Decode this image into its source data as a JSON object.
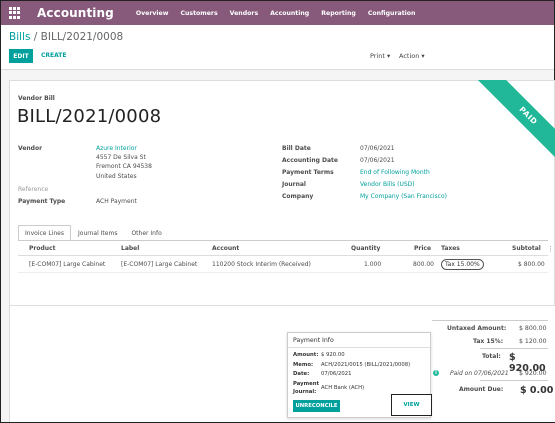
{
  "app": {
    "title": "Accounting",
    "menu": [
      "Overview",
      "Customers",
      "Vendors",
      "Accounting",
      "Reporting",
      "Configuration"
    ]
  },
  "breadcrumb": {
    "parent": "Bills",
    "separator": "/",
    "current": "BILL/2021/0008"
  },
  "toolbar": {
    "edit": "EDIT",
    "create": "CREATE",
    "print": "Print ▾",
    "action": "Action ▾"
  },
  "status_ribbon": {
    "label": "PAID",
    "color": "#21b799"
  },
  "document": {
    "type_label": "Vendor Bill",
    "number": "BILL/2021/0008"
  },
  "left_fields": {
    "vendor_label": "Vendor",
    "vendor_name": "Azure Interior",
    "vendor_address": [
      "4557 De Silva St",
      "Fremont CA 94538",
      "United States"
    ],
    "reference_label": "Reference",
    "payment_type_label": "Payment Type",
    "payment_type_value": "ACH Payment"
  },
  "right_fields": {
    "bill_date_label": "Bill Date",
    "bill_date": "07/06/2021",
    "accounting_date_label": "Accounting Date",
    "accounting_date": "07/06/2021",
    "payment_terms_label": "Payment Terms",
    "payment_terms": "End of Following Month",
    "journal_label": "Journal",
    "journal": "Vendor Bills (USD)",
    "company_label": "Company",
    "company": "My Company (San Francisco)"
  },
  "tabs": [
    "Invoice Lines",
    "Journal Items",
    "Other Info"
  ],
  "table": {
    "columns": {
      "product": "Product",
      "label": "Label",
      "account": "Account",
      "quantity": "Quantity",
      "price": "Price",
      "taxes": "Taxes",
      "subtotal": "Subtotal"
    },
    "rows": [
      {
        "product": "[E-COM07] Large Cabinet",
        "label": "[E-COM07] Large Cabinet",
        "account": "110200 Stock Interim (Received)",
        "quantity": "1.000",
        "price": "800.00",
        "taxes": "Tax 15.00%",
        "subtotal": "$ 800.00"
      }
    ]
  },
  "payment_info": {
    "title": "Payment Info",
    "amount_label": "Amount:",
    "amount": "$ 920.00",
    "memo_label": "Memo:",
    "memo": "ACH/2021/0015 (BILL/2021/0008)",
    "date_label": "Date:",
    "date": "07/06/2021",
    "journal_label_1": "Payment",
    "journal_label_2": "Journal:",
    "journal": "ACH Bank (ACH)",
    "unreconcile": "UNRECONCILE",
    "view": "VIEW"
  },
  "totals": {
    "untaxed_label": "Untaxed Amount:",
    "untaxed": "$ 800.00",
    "tax_label": "Tax 15%:",
    "tax": "$ 120.00",
    "total_label": "Total:",
    "total": "$ 920.00",
    "paid_on": "Paid on 07/06/2021",
    "paid_amount": "$ 920.00",
    "due_label": "Amount Due:",
    "due": "$ 0.00"
  }
}
